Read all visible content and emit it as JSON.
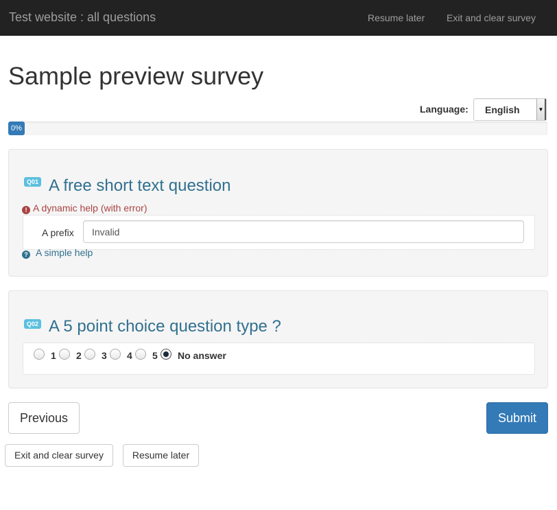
{
  "navbar": {
    "brand": "Test website : all questions",
    "links": [
      "Resume later",
      "Exit and clear survey"
    ]
  },
  "survey": {
    "title": "Sample preview survey",
    "language_label": "Language:",
    "language_value": "English",
    "progress_label": "0%",
    "progress_value": 0
  },
  "questions": [
    {
      "code": "Q01",
      "text": "A free short text question",
      "error_help": "A dynamic help (with error)",
      "prefix": "A prefix",
      "input_value": "Invalid",
      "simple_help": "A simple help"
    },
    {
      "code": "Q02",
      "text": "A 5 point choice question type ?",
      "options": [
        "1",
        "2",
        "3",
        "4",
        "5",
        "No answer"
      ],
      "selected": "No answer"
    }
  ],
  "buttons": {
    "previous": "Previous",
    "submit": "Submit",
    "exit_clear": "Exit and clear survey",
    "resume_later": "Resume later"
  },
  "colors": {
    "navbar": "#222222",
    "primary": "#337ab7",
    "question_text": "#31708f",
    "error": "#a94442",
    "badge": "#5bc0de"
  },
  "icons": [
    "exclamation-circle-icon",
    "question-circle-icon",
    "dropdown-arrow-icon"
  ]
}
